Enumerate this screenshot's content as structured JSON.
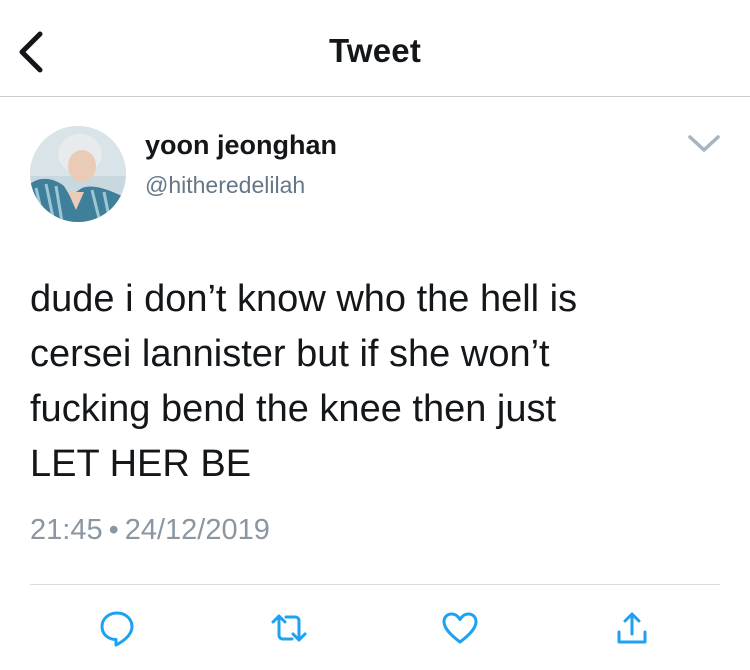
{
  "header": {
    "title": "Tweet",
    "back_icon": "chevron-left-icon"
  },
  "tweet": {
    "author": {
      "display_name": "yoon jeonghan",
      "handle": "@hitheredelilah"
    },
    "text_lines": [
      "dude i don’t know who the hell is",
      "cersei lannister but if she won’t",
      "fucking bend the knee then just",
      "LET HER BE"
    ],
    "time": "21:45",
    "separator": "•",
    "date": "24/12/2019"
  },
  "actions": [
    {
      "icon": "reply-icon"
    },
    {
      "icon": "retweet-icon"
    },
    {
      "icon": "like-icon"
    },
    {
      "icon": "share-icon"
    }
  ],
  "colors": {
    "primary_text": "#14171a",
    "secondary_text": "#657786",
    "icon": "#1da1f2",
    "divider": "#d6dbdf"
  }
}
